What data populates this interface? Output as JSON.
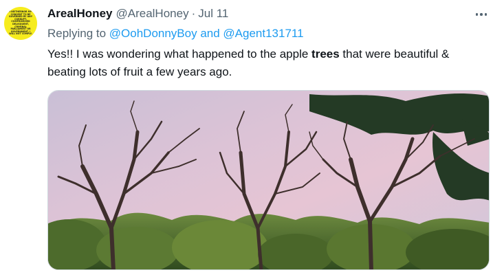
{
  "tweet": {
    "avatar_text": "I NEITHERNOR MY CONSENT TO BE GOVERNED BY ANY CORRUPT, COMPROMISED DELIGQUENT, CRIMINAL PARLIAMENT OR GOVERNMENT. I WILL NOT COMPLY.",
    "display_name": "ArealHoney",
    "handle": "@ArealHoney",
    "separator": "·",
    "date": "Jul 11",
    "replying_prefix": "Replying to ",
    "reply_user_1": "@OohDonnyBoy",
    "reply_conjunction": " and ",
    "reply_user_2": "@Agent131711",
    "text_before": "Yes!! I was wondering what happened to the apple ",
    "text_bold": "trees",
    "text_after": " that were beautiful & beating lots of fruit a few years ago."
  },
  "colors": {
    "accent": "#1d9bf0",
    "secondary_text": "#536471",
    "avatar_bg": "#f6ec1e"
  },
  "icons": {
    "more": "more-horizontal-icon"
  }
}
